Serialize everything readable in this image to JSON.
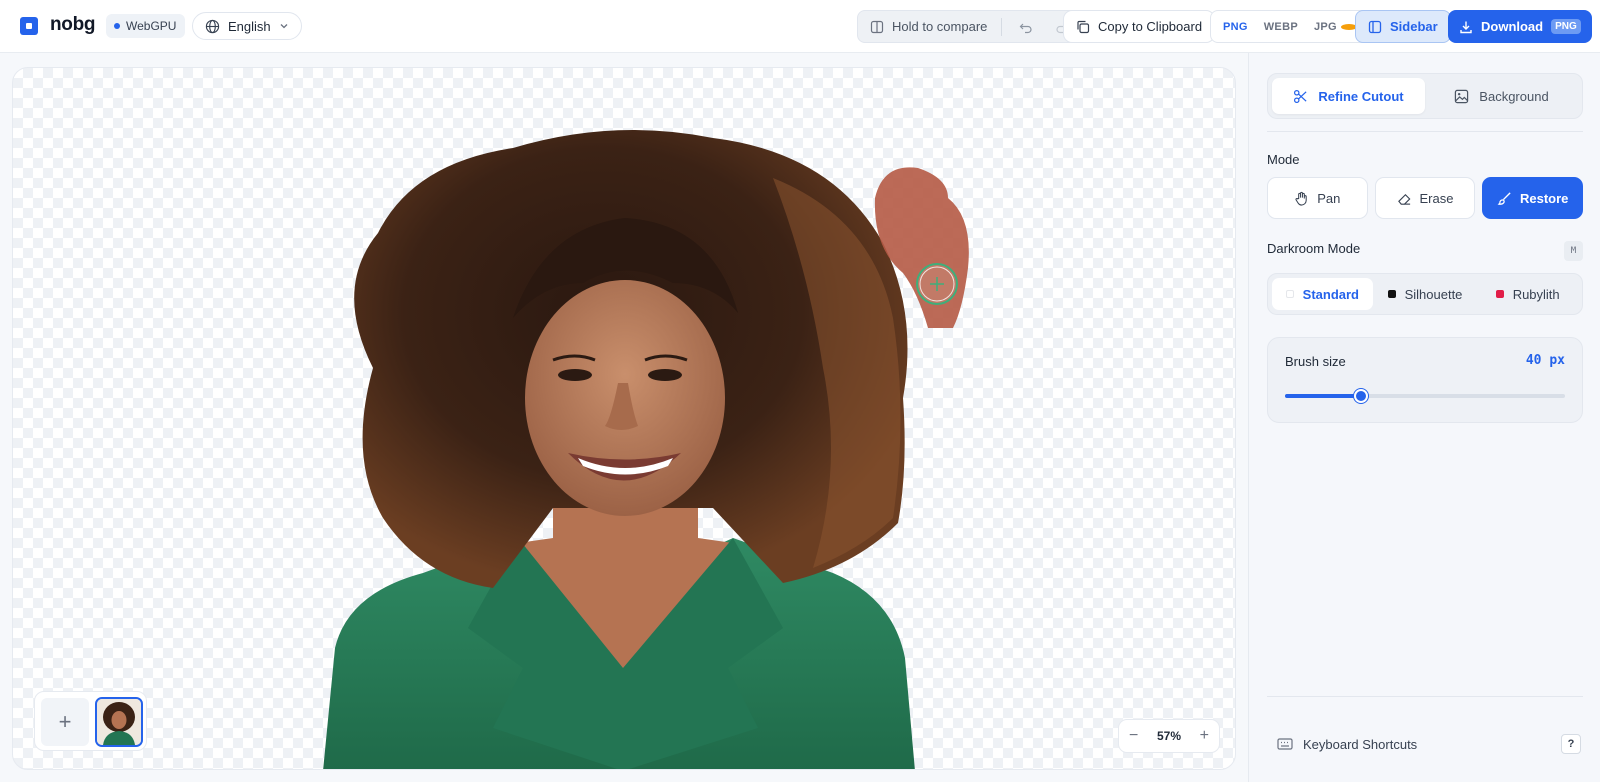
{
  "header": {
    "logo_text": "nobg",
    "webgpu_label": "WebGPU",
    "language": "English",
    "compare_label": "Hold to compare",
    "copy_label": "Copy to Clipboard",
    "formats": [
      "PNG",
      "WEBP",
      "JPG"
    ],
    "active_format": "PNG",
    "sidebar_label": "Sidebar",
    "download_label": "Download",
    "download_badge": "PNG"
  },
  "canvas": {
    "zoom_value": "57%",
    "zoom_out_symbol": "−",
    "zoom_in_symbol": "+",
    "add_symbol": "+"
  },
  "sidebar": {
    "tabs": [
      {
        "label": "Refine Cutout",
        "icon": "scissors-icon",
        "active": true
      },
      {
        "label": "Background",
        "icon": "image-icon",
        "active": false
      }
    ],
    "mode_label": "Mode",
    "modes": [
      {
        "label": "Pan",
        "icon": "hand-icon",
        "active": false
      },
      {
        "label": "Erase",
        "icon": "eraser-icon",
        "active": false
      },
      {
        "label": "Restore",
        "icon": "brush-icon",
        "active": true
      }
    ],
    "darkroom_label": "Darkroom Mode",
    "darkroom_key": "M",
    "darkroom_options": [
      {
        "label": "Standard",
        "swatch": "#ffffff",
        "active": true
      },
      {
        "label": "Silhouette",
        "swatch": "#111111",
        "active": false
      },
      {
        "label": "Rubylith",
        "swatch": "#e11d48",
        "active": false
      }
    ],
    "brush_label": "Brush size",
    "brush_value": "40 px",
    "brush_fraction": 0.27,
    "shortcuts_label": "Keyboard Shortcuts",
    "shortcuts_key": "?"
  },
  "colors": {
    "accent": "#2563eb",
    "jpg_dot": "#f59e0b",
    "restore_paint": "#b55a45",
    "webgpu_dot": "#2563eb"
  }
}
